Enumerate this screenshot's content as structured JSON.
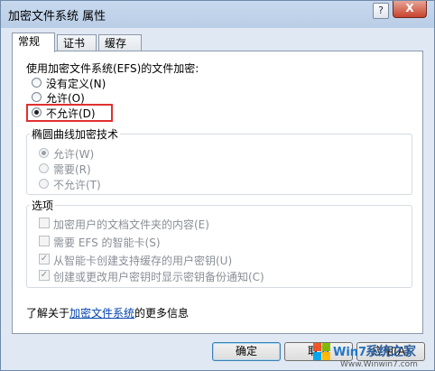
{
  "window": {
    "title": "加密文件系统 属性",
    "help_label": "?",
    "close_label": "X"
  },
  "tabs": [
    {
      "label": "常规",
      "active": true
    },
    {
      "label": "证书",
      "active": false
    },
    {
      "label": "缓存",
      "active": false
    }
  ],
  "efs": {
    "heading": "使用加密文件系统(EFS)的文件加密:",
    "options": [
      {
        "label": "没有定义(N)",
        "checked": false
      },
      {
        "label": "允许(O)",
        "checked": false
      },
      {
        "label": "不允许(D)",
        "checked": true
      }
    ]
  },
  "ecc": {
    "title": "椭圆曲线加密技术",
    "options": [
      {
        "label": "允许(W)",
        "checked": true
      },
      {
        "label": "需要(R)",
        "checked": false
      },
      {
        "label": "不允许(T)",
        "checked": false
      }
    ]
  },
  "options_group": {
    "title": "选项",
    "items": [
      {
        "label": "加密用户的文档文件夹的内容(E)",
        "checked": false
      },
      {
        "label": "需要 EFS 的智能卡(S)",
        "checked": false
      },
      {
        "label": "从智能卡创建支持缓存的用户密钥(U)",
        "checked": true
      },
      {
        "label": "创建或更改用户密钥时显示密钥备份通知(C)",
        "checked": true
      }
    ]
  },
  "info": {
    "prefix": "了解关于",
    "link": "加密文件系统",
    "suffix": "的更多信息"
  },
  "buttons": {
    "ok": "确定",
    "cancel": "取消",
    "apply": "应用(A)"
  },
  "watermark": {
    "brand": "Win7",
    "text": "系统之家",
    "url": "Www.Winwin7.com"
  },
  "colors": {
    "highlight": "#e03030",
    "link": "#0645ad",
    "window_bg": "#dfe8f3"
  }
}
